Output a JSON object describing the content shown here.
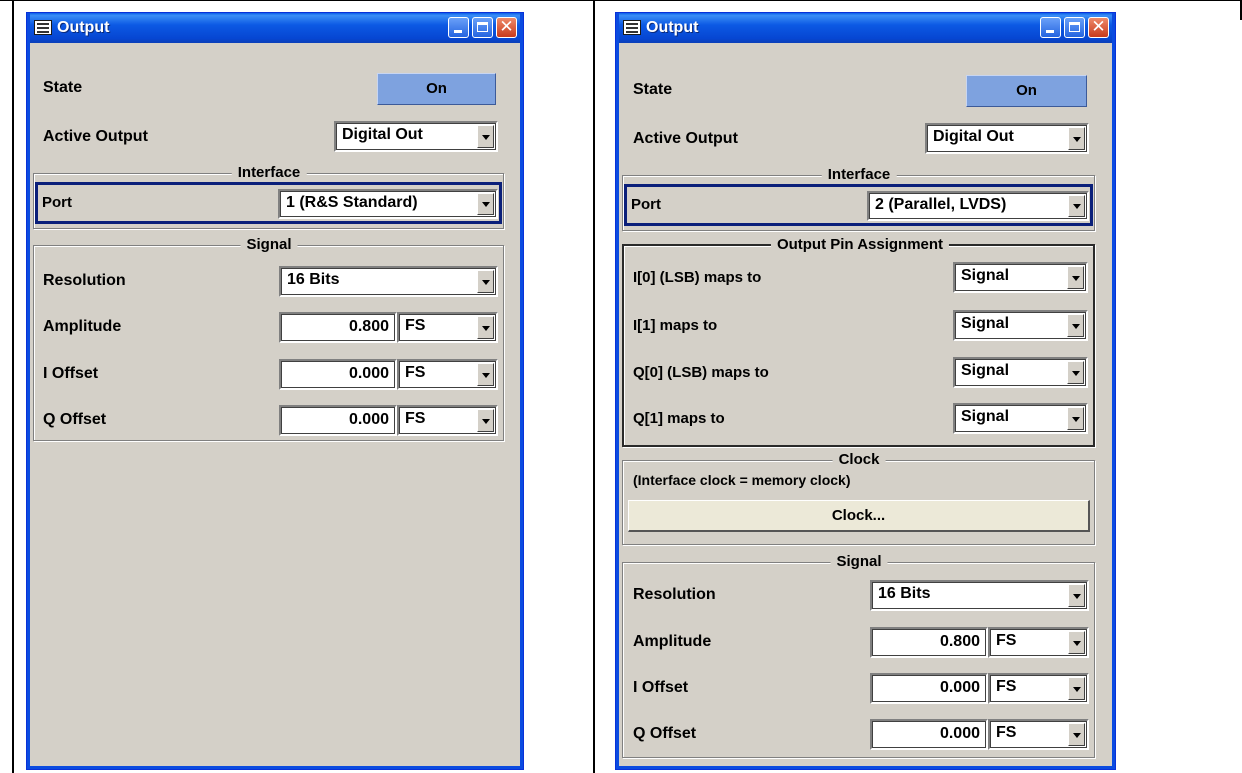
{
  "left_window": {
    "title": "Output",
    "state": {
      "label": "State",
      "button": "On"
    },
    "active_output": {
      "label": "Active Output",
      "value": "Digital Out"
    },
    "interface": {
      "title": "Interface",
      "port_label": "Port",
      "port_value": "1 (R&S Standard)"
    },
    "signal": {
      "title": "Signal",
      "resolution": {
        "label": "Resolution",
        "value": "16 Bits"
      },
      "amplitude": {
        "label": "Amplitude",
        "value": "0.800",
        "unit": "FS"
      },
      "i_offset": {
        "label": "I Offset",
        "value": "0.000",
        "unit": "FS"
      },
      "q_offset": {
        "label": "Q Offset",
        "value": "0.000",
        "unit": "FS"
      }
    }
  },
  "right_window": {
    "title": "Output",
    "state": {
      "label": "State",
      "button": "On"
    },
    "active_output": {
      "label": "Active Output",
      "value": "Digital Out"
    },
    "interface": {
      "title": "Interface",
      "port_label": "Port",
      "port_value": "2 (Parallel, LVDS)"
    },
    "pin_assignment": {
      "title": "Output Pin Assignment",
      "rows": [
        {
          "label": "I[0] (LSB) maps to",
          "value": "Signal"
        },
        {
          "label": "I[1] maps to",
          "value": "Signal"
        },
        {
          "label": "Q[0] (LSB) maps to",
          "value": "Signal"
        },
        {
          "label": "Q[1] maps to",
          "value": "Signal"
        }
      ]
    },
    "clock": {
      "title": "Clock",
      "note": "(Interface clock = memory clock)",
      "button": "Clock..."
    },
    "signal": {
      "title": "Signal",
      "resolution": {
        "label": "Resolution",
        "value": "16 Bits"
      },
      "amplitude": {
        "label": "Amplitude",
        "value": "0.800",
        "unit": "FS"
      },
      "i_offset": {
        "label": "I Offset",
        "value": "0.000",
        "unit": "FS"
      },
      "q_offset": {
        "label": "Q Offset",
        "value": "0.000",
        "unit": "FS"
      }
    }
  },
  "colors": {
    "titlebar": "#0a5ee8",
    "window_bg": "#d4d0c8",
    "on_button": "#7ea2df",
    "focus_border": "#0a1f7a"
  }
}
